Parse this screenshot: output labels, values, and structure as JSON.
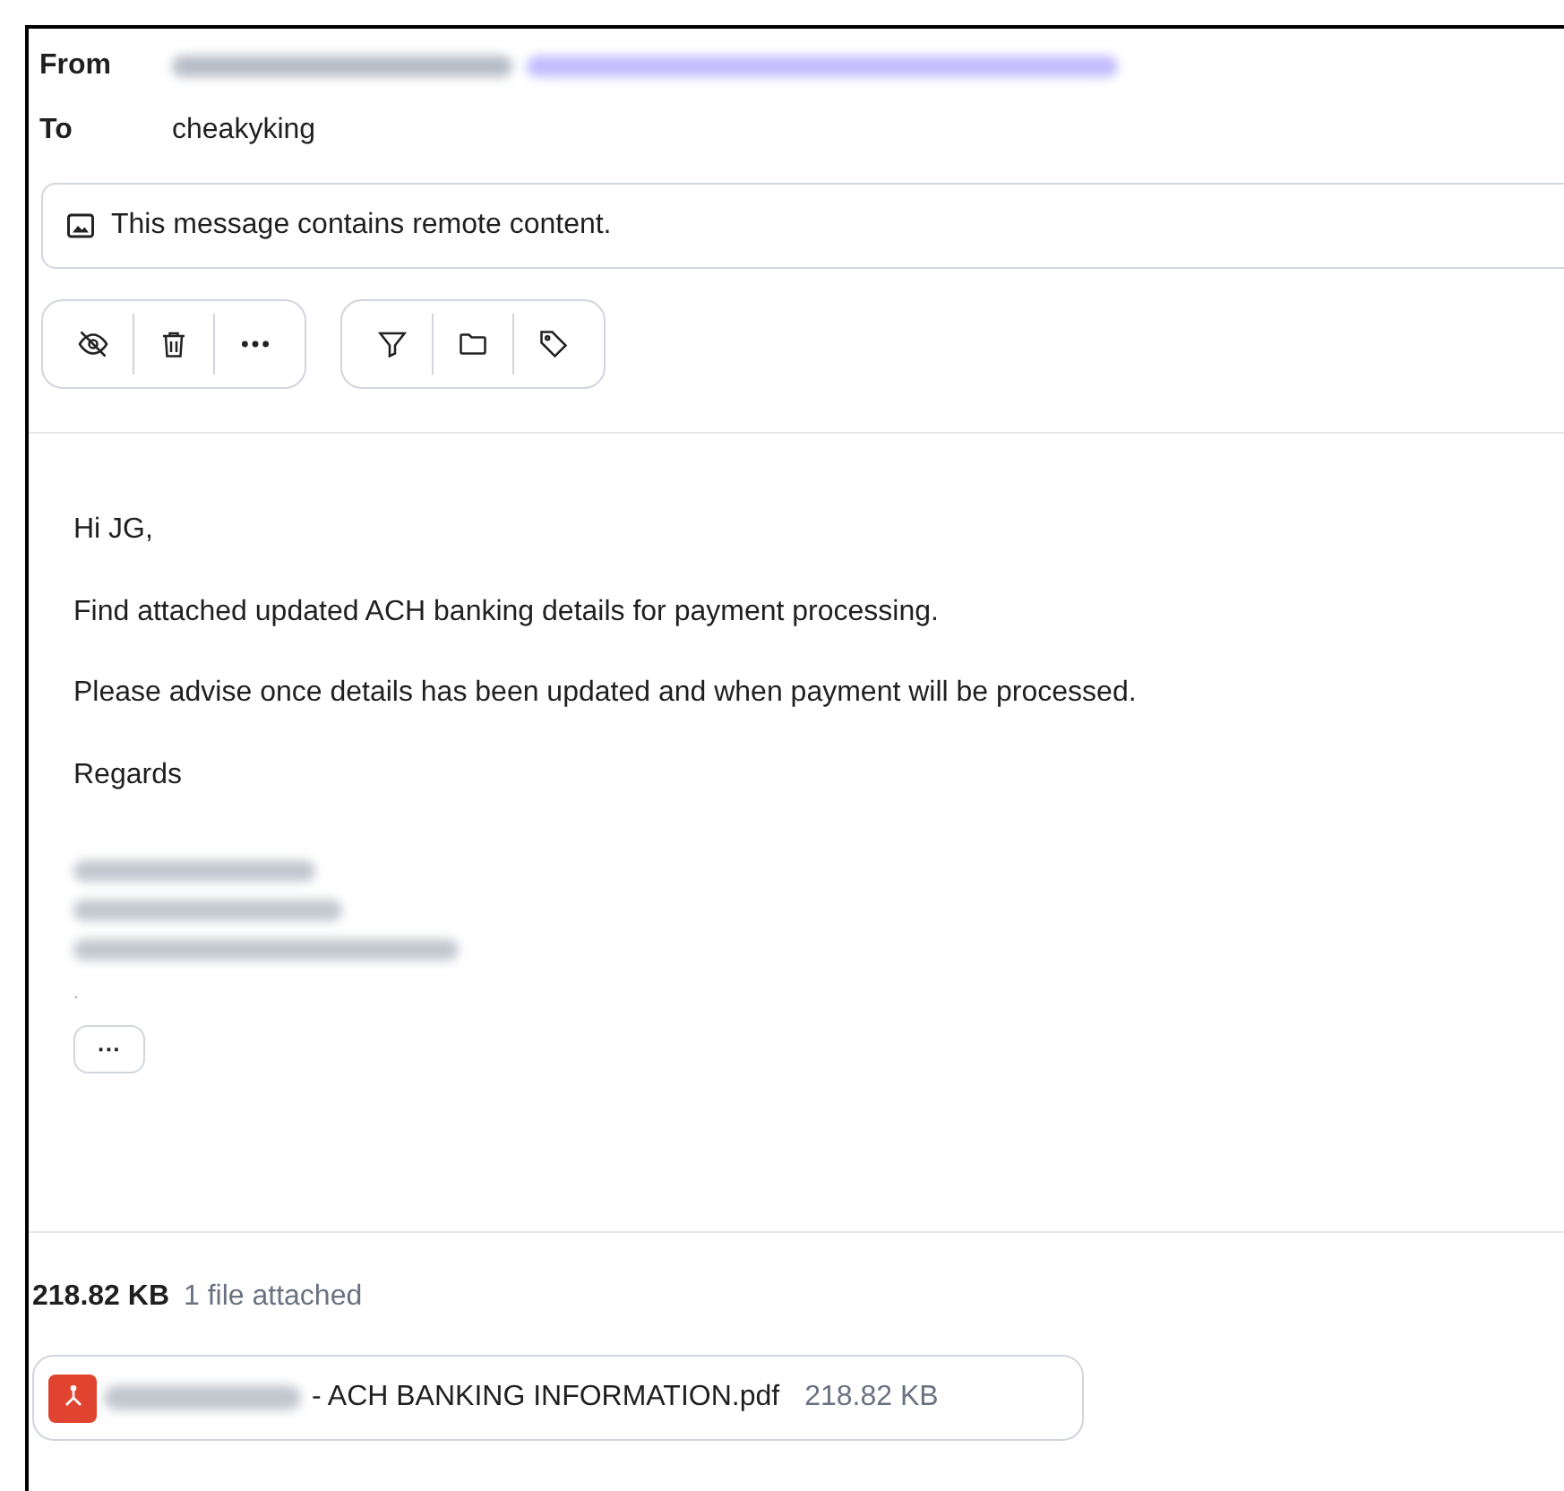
{
  "header": {
    "from": {
      "label": "From",
      "redacted": true
    },
    "to": {
      "label": "To",
      "value": "cheakyking"
    }
  },
  "banner": {
    "text": "This message contains remote content."
  },
  "toolbar": [
    {
      "kind": "group",
      "items": [
        {
          "kind": "eye-off"
        },
        {
          "kind": "trash"
        },
        {
          "kind": "more"
        }
      ]
    },
    {
      "kind": "group",
      "items": [
        {
          "kind": "filter"
        },
        {
          "kind": "folder"
        },
        {
          "kind": "tag"
        }
      ]
    }
  ],
  "body": {
    "paragraphs": [
      "Hi JG,",
      "Find attached updated ACH banking details for payment processing.",
      "Please advise once details has been updated and when payment will be processed.",
      "Regards"
    ],
    "signature_redacted": true,
    "trailing_text": ".",
    "expand_button": "···"
  },
  "attachments": {
    "total_size": "218.82 KB",
    "count_text": "1 file attached",
    "files": [
      {
        "name_redacted": true,
        "name": "- ACH BANKING INFORMATION.pdf",
        "size": "218.82 KB"
      }
    ]
  }
}
